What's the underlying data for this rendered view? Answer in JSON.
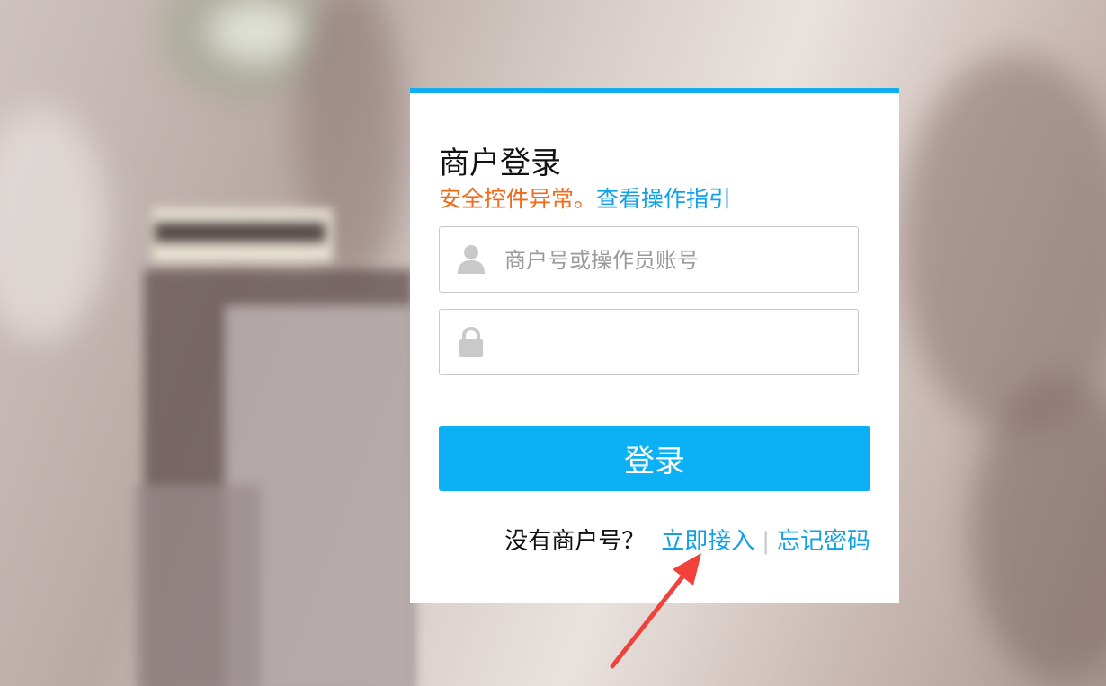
{
  "login_card": {
    "title": "商户登录",
    "warning_text": "安全控件异常。",
    "guide_link": "查看操作指引",
    "username": {
      "placeholder": "商户号或操作员账号",
      "value": "",
      "icon": "user-icon"
    },
    "password": {
      "placeholder": "",
      "value": "",
      "icon": "lock-icon"
    },
    "login_button": "登录",
    "footer": {
      "question": "没有商户号？",
      "signup_link": "立即接入",
      "separator": "|",
      "forgot_link": "忘记密码"
    }
  },
  "colors": {
    "accent": "#12aef0",
    "button": "#0cb0f5",
    "warning": "#f06a1a",
    "link": "#12a1e8",
    "annotation_arrow": "#f0413a"
  }
}
